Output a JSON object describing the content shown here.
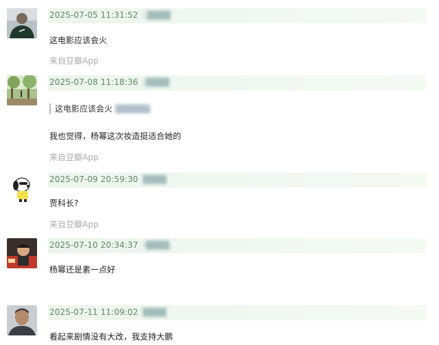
{
  "comments": [
    {
      "time": "2025-07-05 11:31:52",
      "user": "L",
      "text": "这电影应该会火",
      "source": "来自豆瓣App",
      "avatar_icon": "avatar-dark-shirt"
    },
    {
      "time": "2025-07-08 11:18:36",
      "user": "(",
      "quote": "这电影应该会火",
      "text": "我也觉得，杨幂这次妆造挺适合她的",
      "source": "来自豆瓣App",
      "avatar_icon": "avatar-trees"
    },
    {
      "time": "2025-07-09 20:59:30",
      "user": "",
      "text": "贾科长?",
      "source": "来自豆瓣App",
      "avatar_icon": "avatar-snoopy"
    },
    {
      "time": "2025-07-10 20:34:37",
      "user": "r",
      "text": "杨幂还是素一点好",
      "avatar_icon": "avatar-child"
    },
    {
      "time": "2025-07-11 11:09:02",
      "user": "",
      "text": "看起来剧情没有大改，我支持大鹏",
      "avatar_icon": "avatar-man"
    }
  ]
}
